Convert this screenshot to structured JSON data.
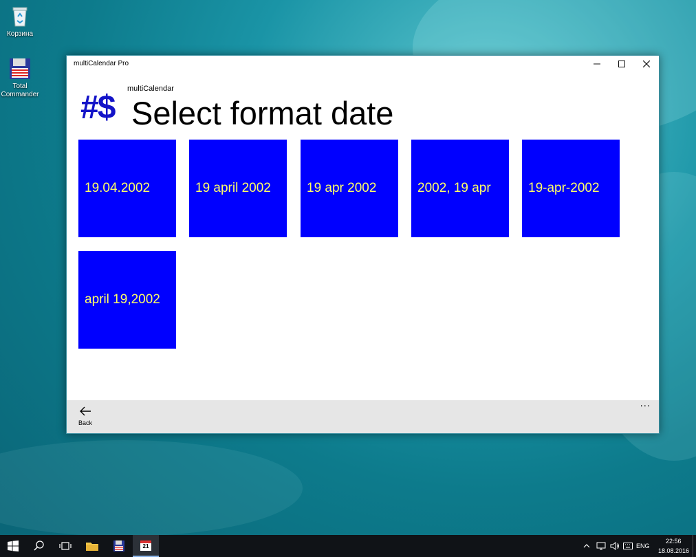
{
  "desktop": {
    "icons": [
      {
        "label": "Корзина"
      },
      {
        "label": "Total Commander"
      }
    ]
  },
  "window": {
    "title": "multiCalendar Pro",
    "controls": {
      "minimize": "—",
      "maximize": "☐",
      "close": "✕"
    }
  },
  "header": {
    "app_name": "multiCalendar",
    "logo": "#$",
    "page_title": "Select format date"
  },
  "formats": [
    "19.04.2002",
    "19 april 2002",
    "19 apr 2002",
    "2002, 19 apr",
    "19-apr-2002",
    "april 19,2002"
  ],
  "appbar": {
    "back_label": "Back",
    "more": "···"
  },
  "taskbar": {
    "language": "ENG",
    "time": "22:56",
    "date": "18.08.2016",
    "calendar_day": "21"
  },
  "colors": {
    "tile_bg": "#0000ff",
    "tile_text": "#ffff66",
    "logo": "#1414c8"
  }
}
